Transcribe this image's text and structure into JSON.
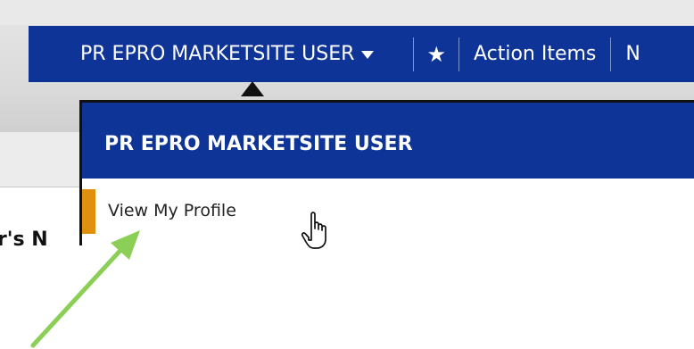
{
  "navbar": {
    "user_label": "PR EPRO MARKETSITE USER",
    "star_icon": "star-icon",
    "action_items_label": "Action Items",
    "cut_item_label": "N"
  },
  "dropdown": {
    "title": "PR EPRO MARKETSITE USER",
    "items": [
      {
        "label": "View My Profile"
      }
    ]
  },
  "background": {
    "heading_fragment": "er's N"
  },
  "colors": {
    "nav_blue": "#0f3498",
    "accent_orange": "#e0900f",
    "annotation_green": "#8ccf57"
  }
}
